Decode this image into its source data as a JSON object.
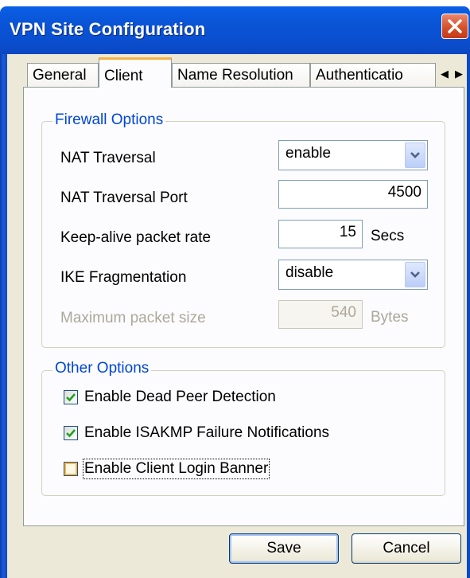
{
  "window": {
    "title": "VPN Site Configuration"
  },
  "tabs": [
    {
      "label": "General",
      "active": false
    },
    {
      "label": "Client",
      "active": true
    },
    {
      "label": "Name Resolution",
      "active": false
    },
    {
      "label": "Authenticatio",
      "active": false
    }
  ],
  "firewall": {
    "title": "Firewall Options",
    "nat_traversal": {
      "label": "NAT Traversal",
      "value": "enable"
    },
    "nat_port": {
      "label": "NAT Traversal Port",
      "value": "4500"
    },
    "keepalive": {
      "label": "Keep-alive packet rate",
      "value": "15",
      "unit": "Secs"
    },
    "ike_frag": {
      "label": "IKE Fragmentation",
      "value": "disable"
    },
    "max_packet": {
      "label": "Maximum packet size",
      "value": "540",
      "unit": "Bytes",
      "disabled": true
    }
  },
  "other": {
    "title": "Other Options",
    "options": [
      {
        "label": "Enable Dead Peer Detection",
        "checked": true
      },
      {
        "label": "Enable ISAKMP Failure Notifications",
        "checked": true
      },
      {
        "label": "Enable Client Login Banner",
        "checked": false
      }
    ]
  },
  "buttons": {
    "save": "Save",
    "cancel": "Cancel"
  },
  "colors": {
    "title_bar": "#0a54d6",
    "group_title": "#0046d5",
    "tab_highlight": "#f3b243",
    "close_button": "#d6502a"
  }
}
